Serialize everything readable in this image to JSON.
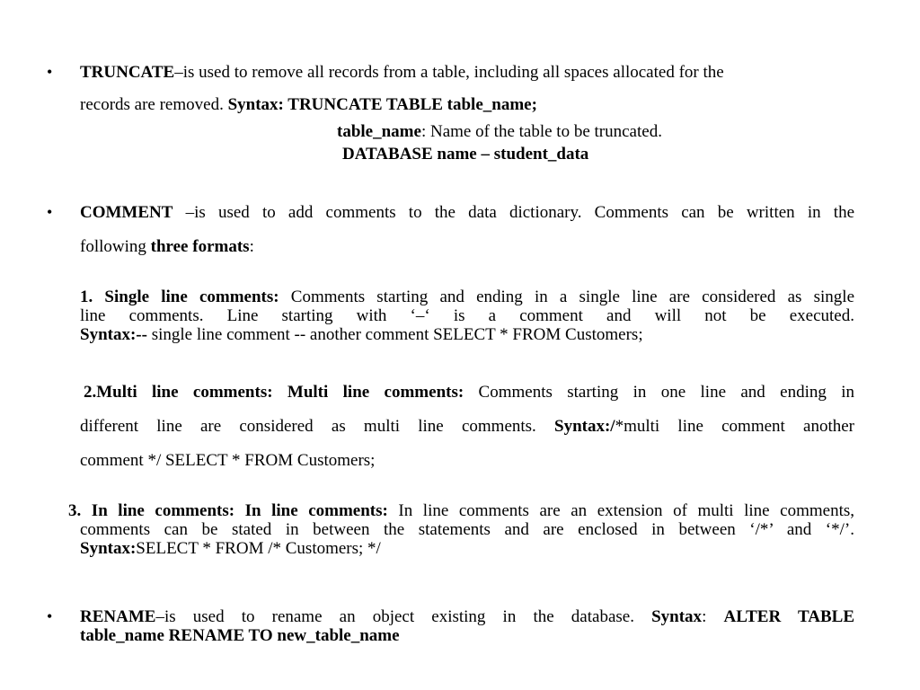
{
  "bullet_glyph": "•",
  "truncate": {
    "term": "TRUNCATE",
    "desc": "–is used to remove all records from a table, including all spaces allocated for the",
    "desc2": "records are removed. ",
    "syntax": "Syntax: TRUNCATE TABLE table_name;",
    "param_term": "table_name",
    "param_desc": ": Name of the table to be truncated.",
    "database": "DATABASE name – student_data"
  },
  "comment": {
    "term": "COMMENT",
    "desc": " –is used to add comments to the data dictionary. Comments can be written in the",
    "desc2_pre": "following ",
    "desc2_bold": "three formats",
    "desc2_post": ":",
    "formats": [
      {
        "heading": "1.  Single line comments:",
        "line1": " Comments starting and ending in a single line are considered as single",
        "line2": "line comments. Line starting with ‘–‘ is a comment and will not be executed.",
        "syntax_label": "Syntax:--",
        "syntax_text": " single line comment -- another comment SELECT * FROM Customers;"
      },
      {
        "heading": "2.Multi line comments: Multi line comments:",
        "line1": " Comments starting in one line and ending in",
        "line2_pre": "different line are considered as multi line comments.  ",
        "syntax_label": "Syntax:/",
        "line2_post": "*multi line comment another",
        "line3": "comment */ SELECT * FROM Customers;"
      },
      {
        "heading": "3.  In line comments: In line comments:",
        "line1": " In line comments are an extension of multi line comments,",
        "line2": "comments can be stated in between the statements and are enclosed in between ‘/*’ and ‘*/’.",
        "syntax_label": "Syntax:",
        "syntax_text": "SELECT * FROM /* Customers; */"
      }
    ]
  },
  "rename": {
    "term": "RENAME",
    "desc": "–is used to rename an object existing in the database. ",
    "syntax_label": "Syntax",
    "colon": ": ",
    "syntax_text1": "ALTER TABLE",
    "syntax_text2": "table_name RENAME TO new_table_name"
  }
}
